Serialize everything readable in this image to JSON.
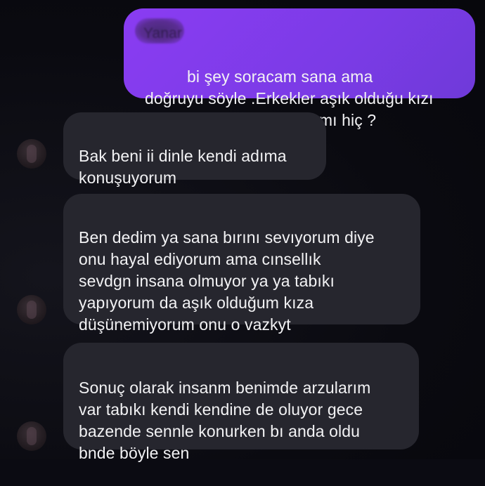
{
  "thread": {
    "messages": [
      {
        "direction": "sent",
        "redacted_prefix": "Yanar",
        "text": "bi şey soracam sana ama\ndoğruyu söyle .Erkekler aşık olduğu kızı\nhayal ederek yapıyorlar mı hiç ?"
      },
      {
        "direction": "received",
        "text": "Bak beni ii dinle kendi adıma\nkonuşuyorum"
      },
      {
        "direction": "received",
        "text": "Ben dedim ya sana bırını sevıyorum diye\nonu hayal ediyorum ama cınsellık\nsevdgn insana olmuyor ya ya tabıkı\nyapıyorum da aşık olduğum kıza\ndüşünemiyorum onu o vazkyt"
      },
      {
        "direction": "received",
        "text": "Sonuç olarak insanm benimde arzularım\nvar tabıkı kendi kendine de oluyor gece\nbazende sennle konurken bı anda oldu\nbnde böyle sen"
      }
    ]
  },
  "colors": {
    "background": "#0b0b12",
    "sent_bubble": "#7b3be6",
    "received_bubble": "#26262e",
    "text": "#f2f2f4"
  }
}
